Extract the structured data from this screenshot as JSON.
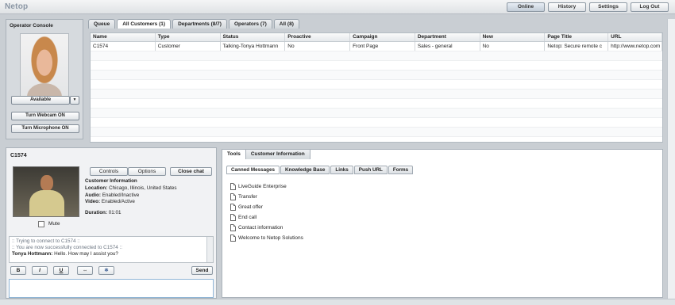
{
  "app": {
    "logo": "Netop"
  },
  "topnav": [
    "Online",
    "History",
    "Settings",
    "Log Out"
  ],
  "console": {
    "title": "Operator Console",
    "status": "Available",
    "webcam_btn": "Turn Webcam ON",
    "mic_btn": "Turn Microphone ON"
  },
  "tabs": [
    "Queue",
    "All Customers (1)",
    "Departments (8/7)",
    "Operators (7)",
    "All (8)"
  ],
  "grid": {
    "headers": [
      "Name",
      "Type",
      "Status",
      "Proactive",
      "Campaign",
      "Department",
      "New",
      "Page Title",
      "URL"
    ],
    "rows": [
      [
        "C1574",
        "Customer",
        "Talking-Tonya Hottmann",
        "No",
        "Front Page",
        "Sales - general",
        "No",
        "Netop: Secure remote c",
        "http://www.netop.com"
      ]
    ]
  },
  "chat": {
    "title": "C1574",
    "controls_btn": "Controls",
    "options_btn": "Options",
    "close_btn": "Close chat",
    "info_heading": "Customer Information",
    "location_label": "Location:",
    "location": "Chicago, Illinois, United States",
    "audio_label": "Audio:",
    "audio": "Enabled/Inactive",
    "video_label": "Video:",
    "video": "Enabled/Active",
    "duration_label": "Duration:",
    "duration": "01:01",
    "mute_label": "Mute",
    "log": [
      ":: Trying to connect to C1574 ::",
      ":: You are now successfully connected to C1574 ::"
    ],
    "message_sender": "Tonya Hottmann:",
    "message_text": "Hello. How may I assist you?",
    "format_buttons": [
      "B",
      "I",
      "U",
      "⇔",
      "✱"
    ],
    "send_btn": "Send"
  },
  "tools": {
    "tabs": [
      "Tools",
      "Customer Information"
    ],
    "subtabs": [
      "Canned Messages",
      "Knowledge Base",
      "Links",
      "Push URL",
      "Forms"
    ],
    "canned": [
      "LiveGuide Enterprise",
      "Transfer",
      "Great offer",
      "End call",
      "Contact information",
      "Welcome to Netop Solutions"
    ]
  }
}
